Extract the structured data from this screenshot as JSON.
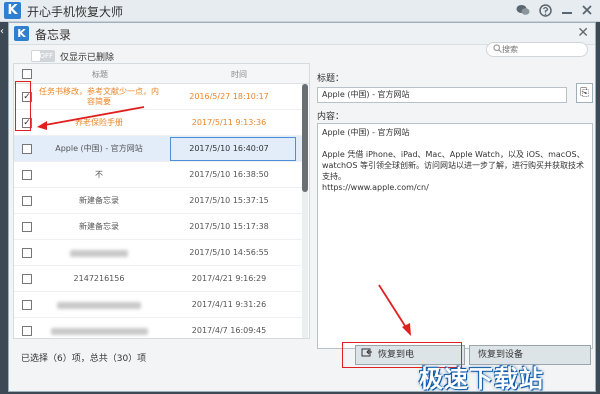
{
  "app": {
    "title": "开心手机恢复大师",
    "logo_letter": "K"
  },
  "dialog": {
    "title": "备忘录",
    "logo_letter": "K"
  },
  "toolbar": {
    "toggle_text": "OFF",
    "toggle_label": "仅显示已删除",
    "search_placeholder": "搜索"
  },
  "list": {
    "col_title": "标题",
    "col_time": "时间",
    "rows": [
      {
        "title": "任务书移改，参考文献少一点，内容简要",
        "time": "2016/5/27 18:10:17",
        "checked": true,
        "state": "orange"
      },
      {
        "title": "养老保险手册",
        "time": "2017/5/11 9:13:36",
        "checked": true,
        "state": "orange"
      },
      {
        "title": "Apple (中国) - 官方网站",
        "time": "2017/5/10 16:40:07",
        "checked": false,
        "state": "selected"
      },
      {
        "title": "不",
        "time": "2017/5/10 16:38:50",
        "checked": false,
        "state": "normal"
      },
      {
        "title": "新建备忘录",
        "time": "2017/5/10 15:37:15",
        "checked": false,
        "state": "normal"
      },
      {
        "title": "新建备忘录",
        "time": "2017/5/10 15:17:38",
        "checked": false,
        "state": "normal"
      },
      {
        "title": "",
        "time": "2017/5/10 14:56:55",
        "checked": false,
        "state": "blurred"
      },
      {
        "title": "2147216156",
        "time": "2017/4/21 9:16:29",
        "checked": false,
        "state": "normal"
      },
      {
        "title": "",
        "time": "2017/4/11 9:31:26",
        "checked": false,
        "state": "blurred"
      },
      {
        "title": "",
        "time": "2017/4/7 16:09:45",
        "checked": false,
        "state": "blurred"
      }
    ],
    "scroll_fraction": 0.42
  },
  "status": "已选择（6）项，总共（30）项",
  "detail": {
    "title_label": "标题：",
    "title_value": "Apple (中国) - 官方网站",
    "content_label": "内容：",
    "content_value": "Apple (中国) - 官方网站\n\nApple 凭借 iPhone、iPad、Mac、Apple Watch，以及 iOS、macOS、watchOS 等引领全球创新。访问网站以进一步了解，进行购买并获取技术支持。\nhttps://www.apple.com/cn/"
  },
  "buttons": {
    "restore_to_pc": "恢复到电",
    "restore_to_device": "恢复到设备"
  },
  "watermark": "极速下载站",
  "icons": [
    "app-logo-icon",
    "wechat-icon",
    "help-icon",
    "minimize-icon",
    "close-icon",
    "search-icon",
    "copy-icon",
    "restore-icon"
  ]
}
